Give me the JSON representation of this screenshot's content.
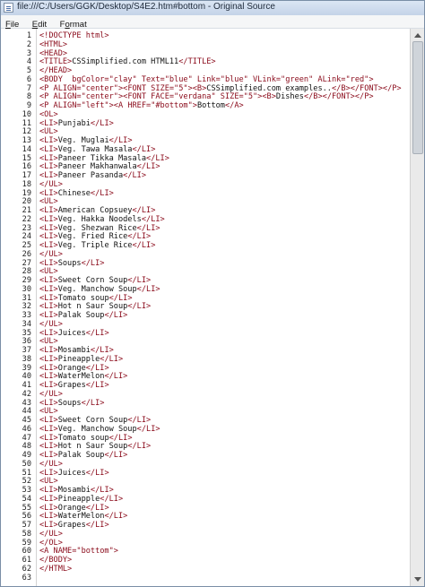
{
  "window": {
    "title": "file:///C:/Users/GGK/Desktop/S4E2.htm#bottom - Original Source",
    "app_icon": "document-icon"
  },
  "menu": {
    "items": [
      {
        "label": "File",
        "u": "F",
        "rest": "ile"
      },
      {
        "label": "Edit",
        "u": "E",
        "rest": "dit"
      },
      {
        "label": "Format",
        "u": "o",
        "pre": "F",
        "rest": "rmat"
      }
    ]
  },
  "source": {
    "line_numbers": [
      "1",
      "2",
      "3",
      "4",
      "5",
      "6",
      "7",
      "8",
      "9",
      "10",
      "11",
      "12",
      "13",
      "14",
      "15",
      "16",
      "17",
      "18",
      "19",
      "20",
      "21",
      "22",
      "23",
      "24",
      "25",
      "26",
      "27",
      "28",
      "29",
      "30",
      "31",
      "32",
      "33",
      "34",
      "35",
      "36",
      "37",
      "38",
      "39",
      "40",
      "41",
      "42",
      "43",
      "44",
      "45",
      "46",
      "47",
      "48",
      "49",
      "50",
      "51",
      "52",
      "53",
      "54",
      "55",
      "56",
      "57",
      "58",
      "59",
      "60",
      "61",
      "62",
      "63"
    ],
    "lines": [
      "<!DOCTYPE html>",
      "<HTML>",
      "<HEAD>",
      "<TITLE>CSSimplified.com HTML11</TITLE>",
      "</HEAD>",
      "<BODY  bgColor=\"clay\" Text=\"blue\" Link=\"blue\" VLink=\"green\" ALink=\"red\">",
      "<P ALIGN=\"center\"><FONT SIZE=\"5\"><B>CSSimplified.com examples..</B></FONT></P>",
      "<P ALIGN=\"center\"><FONT FACE=\"verdana\" SIZE=\"5\"><B>Dishes</B></FONT></P>",
      "<P ALIGN=\"left\"><A HREF=\"#bottom\">Bottom</A>",
      "<OL>",
      "<LI>Punjabi</LI>",
      "<UL>",
      "<LI>Veg. Muglai</LI>",
      "<LI>Veg. Tawa Masala</LI>",
      "<LI>Paneer Tikka Masala</LI>",
      "<LI>Paneer Makhanwala</LI>",
      "<LI>Paneer Pasanda</LI>",
      "</UL>",
      "<LI>Chinese</LI>",
      "<UL>",
      "<LI>American Copsuey</LI>",
      "<LI>Veg. Hakka Noodels</LI>",
      "<LI>Veg. Shezwan Rice</LI>",
      "<LI>Veg. Fried Rice</LI>",
      "<LI>Veg. Triple Rice</LI>",
      "</UL>",
      "<LI>Soups</LI>",
      "<UL>",
      "<LI>Sweet Corn Soup</LI>",
      "<LI>Veg. Manchow Soup</LI>",
      "<LI>Tomato soup</LI>",
      "<LI>Hot n Saur Soup</LI>",
      "<LI>Palak Soup</LI>",
      "</UL>",
      "<LI>Juices</LI>",
      "<UL>",
      "<LI>Mosambi</LI>",
      "<LI>Pineapple</LI>",
      "<LI>Orange</LI>",
      "<LI>WaterMelon</LI>",
      "<LI>Grapes</LI>",
      "</UL>",
      "<LI>Soups</LI>",
      "<UL>",
      "<LI>Sweet Corn Soup</LI>",
      "<LI>Veg. Manchow Soup</LI>",
      "<LI>Tomato soup</LI>",
      "<LI>Hot n Saur Soup</LI>",
      "<LI>Palak Soup</LI>",
      "</UL>",
      "<LI>Juices</LI>",
      "<UL>",
      "<LI>Mosambi</LI>",
      "<LI>Pineapple</LI>",
      "<LI>Orange</LI>",
      "<LI>WaterMelon</LI>",
      "<LI>Grapes</LI>",
      "</UL>",
      "</OL>",
      "<A NAME=\"bottom\">",
      "</BODY>",
      "</HTML>",
      ""
    ]
  },
  "colors": {
    "tag": "#8a0a1a",
    "text": "#111111",
    "attr": "#2a2a2a"
  }
}
